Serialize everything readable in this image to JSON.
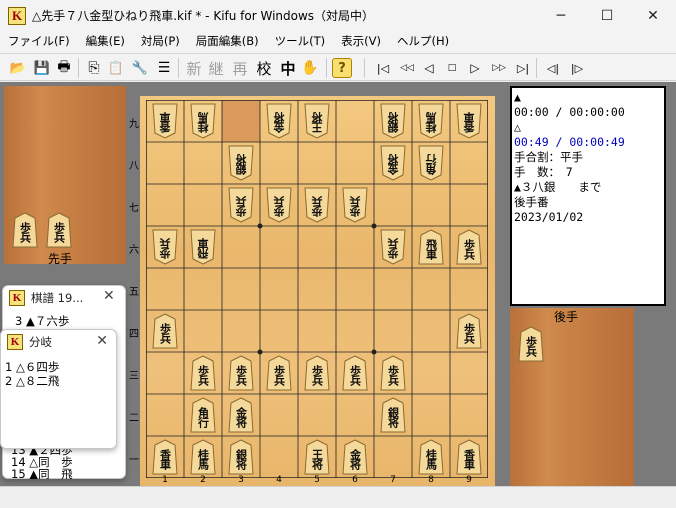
{
  "window": {
    "title": "△先手７八金型ひねり飛車.kif * - Kifu for Windows（対局中）",
    "app_icon_glyph": "K",
    "minimize_glyph": "─",
    "maximize_glyph": "☐",
    "close_glyph": "✕"
  },
  "menu": [
    "ファイル(F)",
    "編集(E)",
    "対局(P)",
    "局面編集(B)",
    "ツール(T)",
    "表示(V)",
    "ヘルプ(H)"
  ],
  "toolbar": {
    "open_icon": "📂",
    "save_icon": "💾",
    "print_icon": "🖶",
    "copy_icon": "⎘",
    "paste_icon": "📋",
    "tools_icon": "🔧",
    "list_icon": "☰",
    "new_label": "新",
    "continue_label": "継",
    "replay_label": "再",
    "check_label": "校",
    "interrupt_label": "中",
    "hand_icon": "✋",
    "help_icon": "?",
    "nav_first": "|◁",
    "nav_back10": "◁◁",
    "nav_back": "◁",
    "nav_stop": "□",
    "nav_forward": "▷",
    "nav_forward10": "▷▷",
    "nav_last": "▷|",
    "nav_branch_back": "◁|",
    "nav_branch_fwd": "|▷"
  },
  "board": {
    "rank_labels": [
      "九",
      "八",
      "七",
      "六",
      "五",
      "四",
      "三",
      "二",
      "一"
    ],
    "file_labels": [
      "1",
      "2",
      "3",
      "4",
      "5",
      "6",
      "7",
      "8",
      "9"
    ],
    "highlight": {
      "col": 3,
      "row": 1
    },
    "pieces": [
      {
        "col": 1,
        "row": 1,
        "text": "香車",
        "gote": true
      },
      {
        "col": 2,
        "row": 1,
        "text": "桂馬",
        "gote": true
      },
      {
        "col": 4,
        "row": 1,
        "text": "金将",
        "gote": true
      },
      {
        "col": 5,
        "row": 1,
        "text": "王将",
        "gote": true
      },
      {
        "col": 7,
        "row": 1,
        "text": "銀将",
        "gote": true
      },
      {
        "col": 8,
        "row": 1,
        "text": "桂馬",
        "gote": true
      },
      {
        "col": 9,
        "row": 1,
        "text": "香車",
        "gote": true
      },
      {
        "col": 3,
        "row": 2,
        "text": "銀将",
        "gote": true
      },
      {
        "col": 7,
        "row": 2,
        "text": "金将",
        "gote": true
      },
      {
        "col": 8,
        "row": 2,
        "text": "角行",
        "gote": true
      },
      {
        "col": 3,
        "row": 3,
        "text": "歩兵",
        "gote": true
      },
      {
        "col": 4,
        "row": 3,
        "text": "歩兵",
        "gote": true
      },
      {
        "col": 5,
        "row": 3,
        "text": "歩兵",
        "gote": true
      },
      {
        "col": 6,
        "row": 3,
        "text": "歩兵",
        "gote": true
      },
      {
        "col": 1,
        "row": 4,
        "text": "歩兵",
        "gote": true
      },
      {
        "col": 2,
        "row": 4,
        "text": "飛車",
        "gote": true
      },
      {
        "col": 7,
        "row": 4,
        "text": "歩兵",
        "gote": true
      },
      {
        "col": 8,
        "row": 4,
        "text": "飛車",
        "gote": false
      },
      {
        "col": 9,
        "row": 4,
        "text": "歩兵",
        "gote": false
      },
      {
        "col": 1,
        "row": 6,
        "text": "歩兵",
        "gote": false
      },
      {
        "col": 9,
        "row": 6,
        "text": "歩兵",
        "gote": false
      },
      {
        "col": 2,
        "row": 7,
        "text": "歩兵",
        "gote": false
      },
      {
        "col": 3,
        "row": 7,
        "text": "歩兵",
        "gote": false
      },
      {
        "col": 4,
        "row": 7,
        "text": "歩兵",
        "gote": false
      },
      {
        "col": 5,
        "row": 7,
        "text": "歩兵",
        "gote": false
      },
      {
        "col": 6,
        "row": 7,
        "text": "歩兵",
        "gote": false
      },
      {
        "col": 7,
        "row": 7,
        "text": "歩兵",
        "gote": false
      },
      {
        "col": 2,
        "row": 8,
        "text": "角行",
        "gote": false
      },
      {
        "col": 3,
        "row": 8,
        "text": "金将",
        "gote": false
      },
      {
        "col": 7,
        "row": 8,
        "text": "銀将",
        "gote": false
      },
      {
        "col": 1,
        "row": 9,
        "text": "香車",
        "gote": false
      },
      {
        "col": 2,
        "row": 9,
        "text": "桂馬",
        "gote": false
      },
      {
        "col": 3,
        "row": 9,
        "text": "銀将",
        "gote": false
      },
      {
        "col": 5,
        "row": 9,
        "text": "王将",
        "gote": false
      },
      {
        "col": 6,
        "row": 9,
        "text": "金将",
        "gote": false
      },
      {
        "col": 8,
        "row": 9,
        "text": "桂馬",
        "gote": false
      },
      {
        "col": 9,
        "row": 9,
        "text": "香車",
        "gote": false
      }
    ]
  },
  "sente_stand": {
    "label": "先手",
    "pieces": [
      "歩兵",
      "歩兵"
    ]
  },
  "gote_stand": {
    "label": "後手",
    "pieces": [
      "歩兵"
    ]
  },
  "info": {
    "sente_mark": "▲",
    "sente_time": "00:00 / 00:00:00",
    "gote_mark": "△",
    "gote_time": "00:49 / 00:00:49",
    "handicap": "手合割：平手",
    "move_count": "手　数：　7",
    "last_move": "▲３八銀　　まで",
    "turn": "後手番",
    "date": "2023/01/02",
    "gote_time_color": "#0000c0"
  },
  "kifu_panel": {
    "title": "棋譜 19...",
    "top_line": "3 ▲７六歩",
    "bottom_lines": [
      "13 ▲２四歩",
      "14 △同　歩",
      "15 ▲同　飛"
    ]
  },
  "branch_panel": {
    "title": "分岐",
    "lines": [
      "1 △６四歩",
      "2 △８二飛"
    ]
  }
}
